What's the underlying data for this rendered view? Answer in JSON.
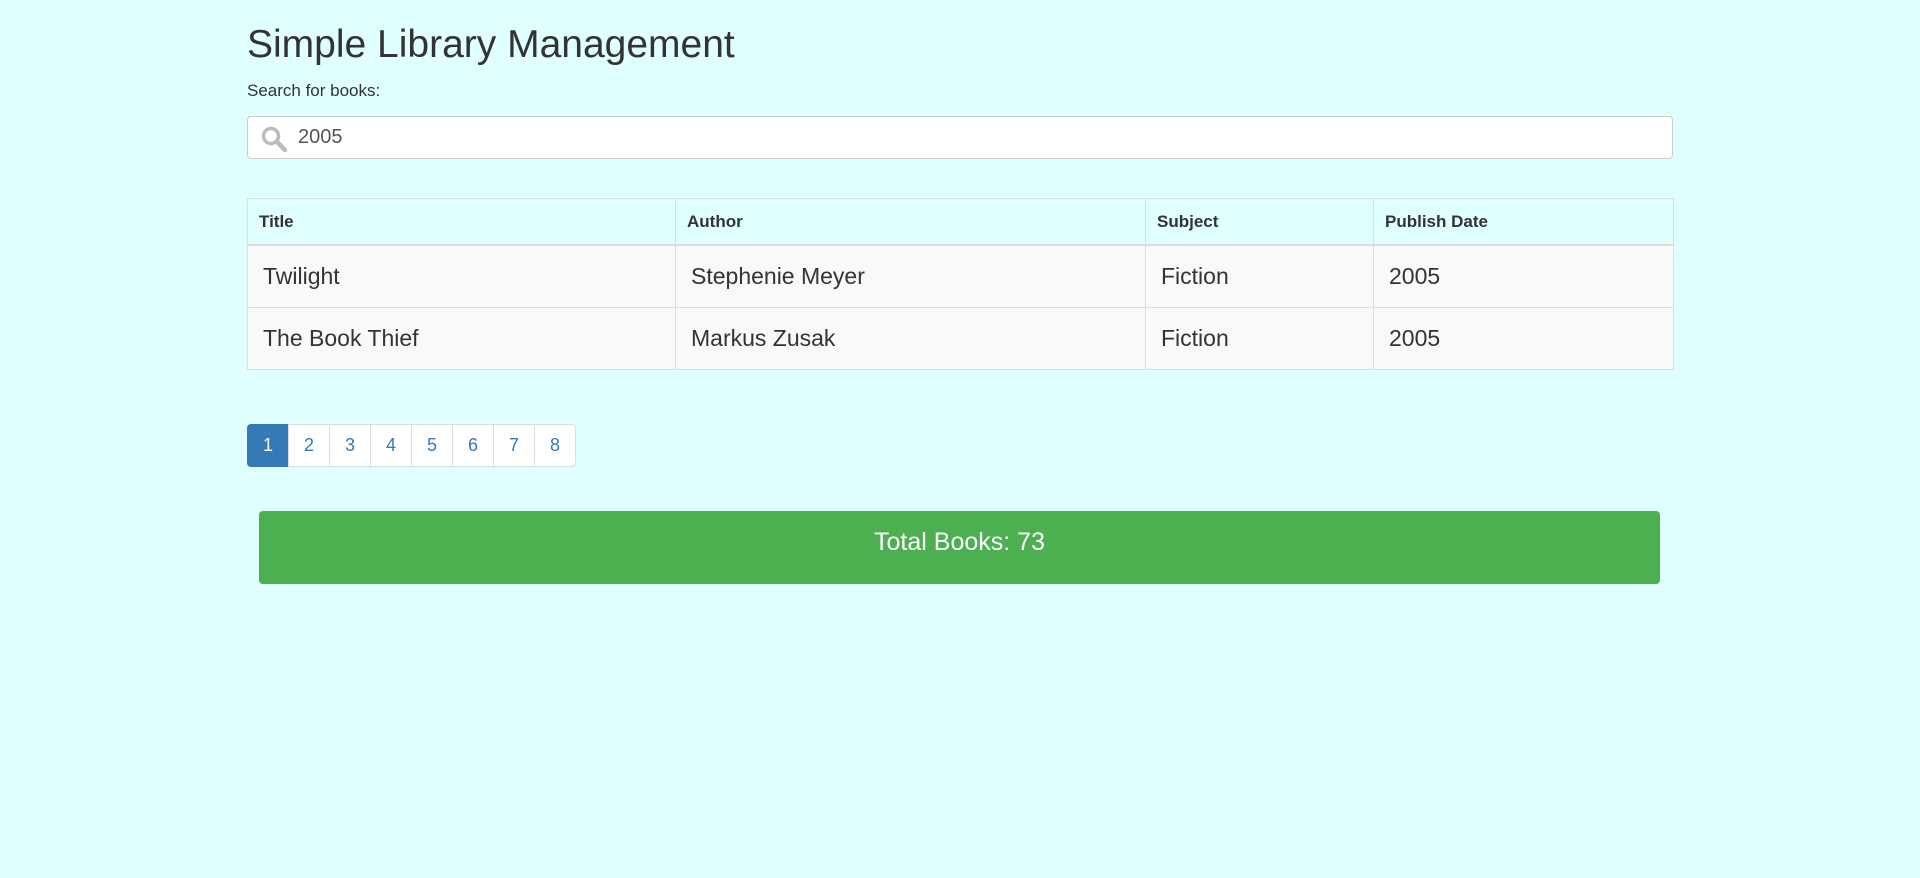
{
  "header": {
    "title": "Simple Library Management"
  },
  "search": {
    "label": "Search for books:",
    "value": "2005",
    "icon": "search-icon"
  },
  "table": {
    "columns": [
      "Title",
      "Author",
      "Subject",
      "Publish Date"
    ],
    "rows": [
      {
        "title": "Twilight",
        "author": "Stephenie Meyer",
        "subject": "Fiction",
        "publish_date": "2005"
      },
      {
        "title": "The Book Thief",
        "author": "Markus Zusak",
        "subject": "Fiction",
        "publish_date": "2005"
      }
    ]
  },
  "pagination": {
    "pages": [
      "1",
      "2",
      "3",
      "4",
      "5",
      "6",
      "7",
      "8"
    ],
    "current": "1"
  },
  "summary": {
    "total_label": "Total Books: 73"
  },
  "colors": {
    "background": "#e0ffff",
    "accent": "#337ab7",
    "banner": "#4cb050"
  }
}
